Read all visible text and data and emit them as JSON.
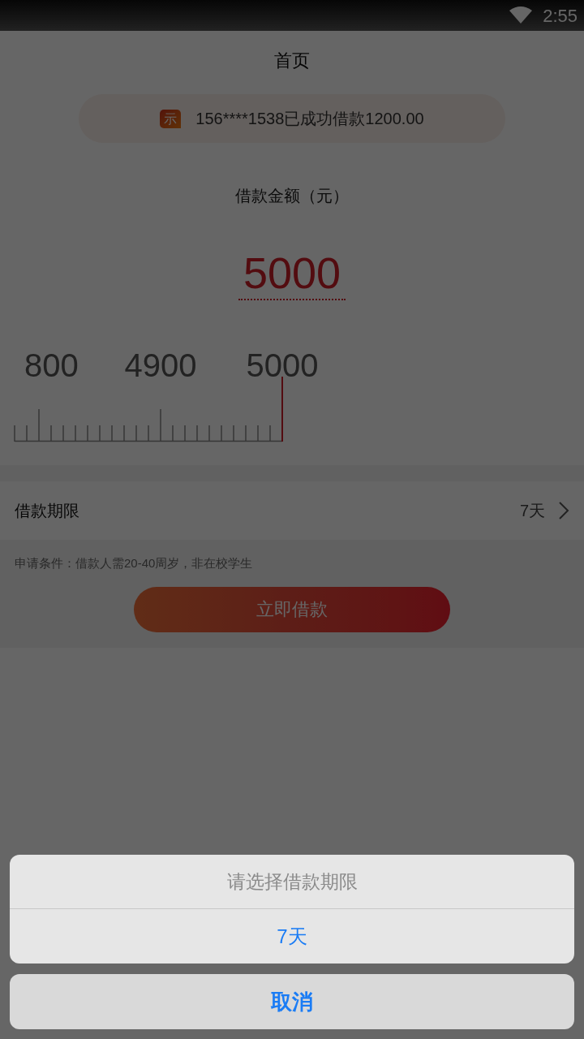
{
  "status_bar": {
    "time": "2:55"
  },
  "header": {
    "title": "首页"
  },
  "notice": {
    "icon_text": "示",
    "text": "156****1538已成功借款1200.00"
  },
  "amount": {
    "label": "借款金额（元）",
    "value": "5000"
  },
  "ruler": {
    "labels": [
      {
        "text": "800",
        "kind": "cut"
      },
      {
        "text": "4900",
        "kind": "full"
      },
      {
        "text": "5000",
        "kind": "full"
      }
    ]
  },
  "term": {
    "label": "借款期限",
    "value": "7天"
  },
  "condition": "申请条件：借款人需20-40周岁，非在校学生",
  "apply_button": "立即借款",
  "sheet": {
    "title": "请选择借款期限",
    "options": [
      "7天"
    ],
    "cancel": "取消"
  }
}
